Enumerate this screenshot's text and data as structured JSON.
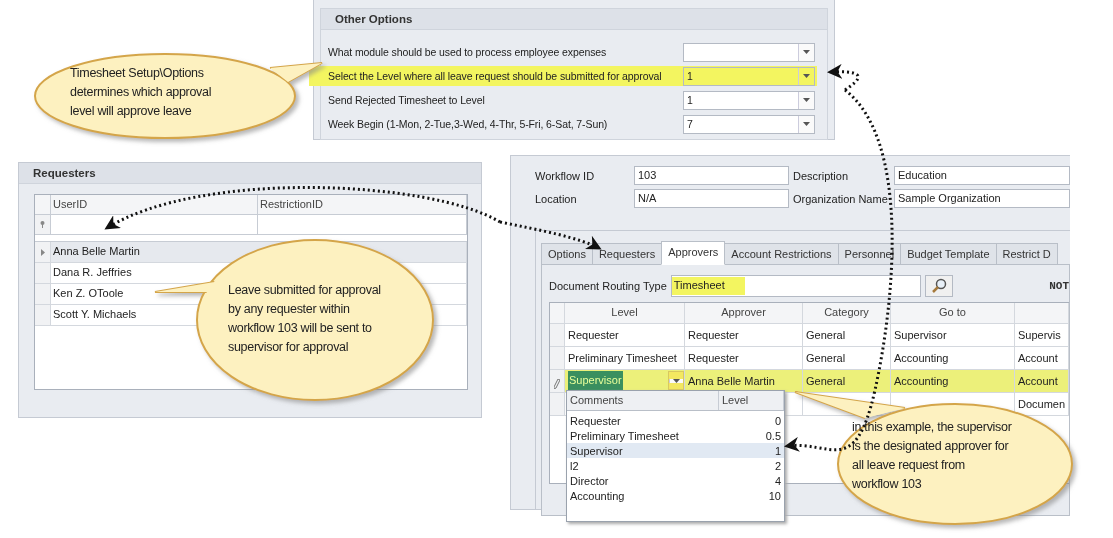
{
  "other_options": {
    "title": "Other Options",
    "rows": [
      {
        "label": "What module should be used to process employee expenses",
        "highlighted": false
      },
      {
        "label": "Select the Level where all leave request should be submitted for approval",
        "value": "1",
        "highlighted": true
      },
      {
        "label": "Send Rejected Timesheet to Level",
        "value": "1",
        "highlighted": false
      },
      {
        "label": "Week Begin (1-Mon, 2-Tue,3-Wed, 4-Thr, 5-Fri, 6-Sat, 7-Sun)",
        "value": "7",
        "highlighted": false
      }
    ]
  },
  "requesters": {
    "title": "Requesters",
    "columns": [
      "UserID",
      "RestrictionID"
    ],
    "rows": [
      {
        "user_id": "Anna Belle Martin",
        "selected": true
      },
      {
        "user_id": "Dana R. Jeffries",
        "selected": false
      },
      {
        "user_id": "Ken Z. OToole",
        "selected": false
      },
      {
        "user_id": "Scott Y. Michaels",
        "selected": false
      }
    ]
  },
  "workflow": {
    "fields": [
      {
        "label": "Workflow ID",
        "value": "103"
      },
      {
        "label": "Description",
        "value": "Education"
      },
      {
        "label": "Location",
        "value": "N/A"
      },
      {
        "label": "Organization Name",
        "value": "Sample Organization"
      }
    ],
    "tabs": [
      {
        "label": "Options",
        "selected": false
      },
      {
        "label": "Requesters",
        "selected": false
      },
      {
        "label": "Approvers",
        "selected": true
      },
      {
        "label": "Account Restrictions",
        "selected": false
      },
      {
        "label": "Personnel",
        "selected": false
      },
      {
        "label": "Budget Template",
        "selected": false
      },
      {
        "label": "Restrict D",
        "selected": false
      }
    ],
    "document_routing_type": {
      "label": "Document Routing Type",
      "value": "Timesheet",
      "highlighted": true
    },
    "note": "NOT",
    "approvers": {
      "columns": [
        "Level",
        "Approver",
        "Category",
        "Go to"
      ],
      "rows": [
        {
          "level_name": "Requester",
          "approver": "Requester",
          "category": "General",
          "go_to": "Supervisor",
          "column_5": "Supervis",
          "highlighted": false,
          "editing": false
        },
        {
          "level_name": "Preliminary Timesheet",
          "approver": "Requester",
          "category": "General",
          "go_to": "Accounting",
          "column_5": "Account",
          "highlighted": false,
          "editing": false
        },
        {
          "level_name": "Supervisor",
          "approver": "Anna Belle Martin",
          "category": "General",
          "go_to": "Accounting",
          "column_5": "Account",
          "highlighted": true,
          "editing": true
        },
        {
          "column_5": "Documen",
          "highlighted": false,
          "editing": false
        }
      ]
    },
    "level_dropdown": {
      "columns": [
        "Comments",
        "Level"
      ],
      "items": [
        {
          "comment": "Requester",
          "value": "0",
          "selected": false
        },
        {
          "comment": "Preliminary Timesheet",
          "value": "0.5",
          "selected": false
        },
        {
          "comment": "Supervisor",
          "value": "1",
          "selected": true
        },
        {
          "comment": "l2",
          "value": "2",
          "selected": false
        },
        {
          "comment": "Director",
          "value": "4",
          "selected": false
        },
        {
          "comment": "Accounting",
          "value": "10",
          "selected": false
        }
      ]
    }
  },
  "callouts": [
    {
      "text": "Timesheet Setup\\Options\ndetermines which approval\nlevel will approve leave"
    },
    {
      "text": "Leave submitted for approval\nby any requester within\nworkflow 103 will be sent to\nsupervisor for approval"
    },
    {
      "text": "in this example, the supervisor\nis the designated approver  for\nall leave request from\nworkflow 103"
    }
  ]
}
